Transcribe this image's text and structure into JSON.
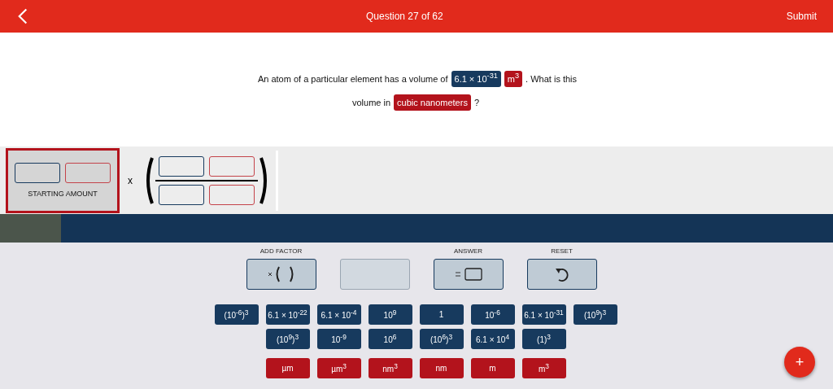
{
  "header": {
    "title": "Question 27 of 62",
    "submit": "Submit"
  },
  "question": {
    "parts": [
      {
        "kind": "text",
        "text": "An atom of a particular element has a volume of"
      },
      {
        "kind": "number",
        "text": "6.1 × 10$^{-31}$"
      },
      {
        "kind": "unit",
        "text": "m$^{3}$"
      },
      {
        "kind": "text",
        "text": ". What is this volume in"
      },
      {
        "kind": "unit",
        "text": "cubic nanometers"
      },
      {
        "kind": "text",
        "text": "?"
      }
    ]
  },
  "workspace": {
    "starting_amount_label": "STARTING AMOUNT",
    "times": "x"
  },
  "progress": {
    "level": 0.073
  },
  "controls": [
    {
      "label": "ADD FACTOR",
      "kind": "factor",
      "disabled": false
    },
    {
      "kind": "blank",
      "disabled": true
    },
    {
      "label": "ANSWER",
      "kind": "answer",
      "disabled": false
    },
    {
      "label": "RESET",
      "kind": "reset",
      "disabled": false
    }
  ],
  "tile_rows": [
    {
      "kind": "number",
      "tiles": [
        "(10$^{-6}$)$^{3}$",
        "6.1 × 10$^{-22}$",
        "6.1 × 10$^{-4}$",
        "10$^{9}$",
        "1",
        "10$^{-6}$",
        "6.1 × 10$^{-31}$",
        "(10$^{9}$)$^{3}$"
      ]
    },
    {
      "kind": "number",
      "tiles": [
        "(10$^{9}$)$^{3}$",
        "10$^{-9}$",
        "10$^{6}$",
        "(10$^{6}$)$^{3}$",
        "6.1 × 10$^{4}$",
        "(1)$^{3}$"
      ]
    },
    {
      "kind": "unit",
      "tiles": [
        "µm",
        "µm$^{3}$",
        "nm$^{3}$",
        "nm",
        "m",
        "m$^{3}$"
      ]
    }
  ],
  "fab": "+"
}
